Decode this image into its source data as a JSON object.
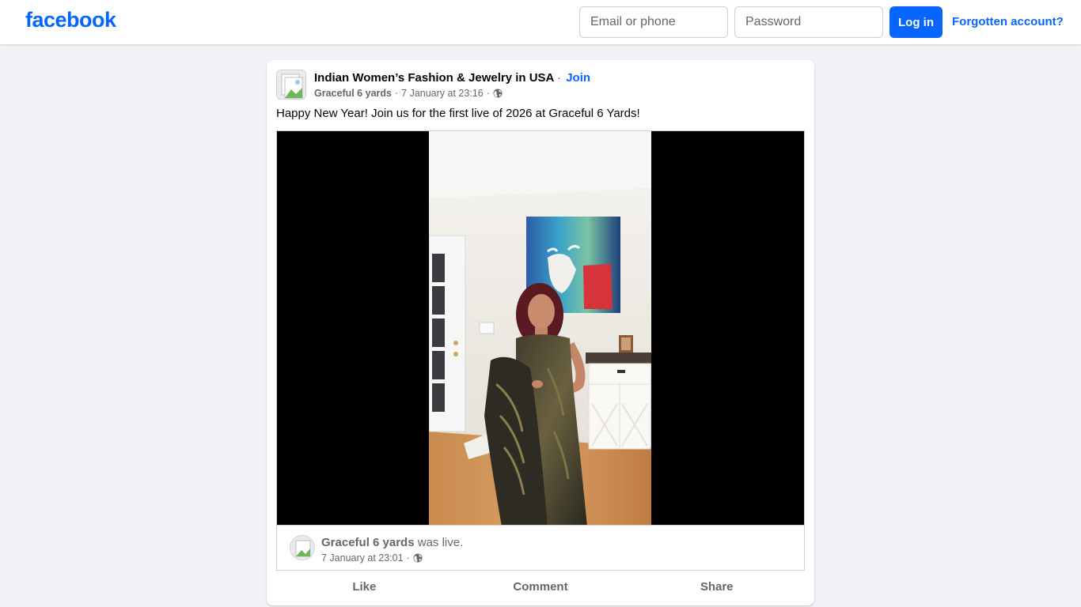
{
  "header": {
    "logo": "facebook",
    "email_placeholder": "Email or phone",
    "password_placeholder": "Password",
    "login_label": "Log in",
    "forgot_label": "Forgotten account?"
  },
  "post": {
    "group_name": "Indian Women’s Fashion & Jewelry in USA",
    "separator": "·",
    "join_label": "Join",
    "author": "Graceful 6 yards",
    "timestamp": "7 January at 23:16",
    "privacy_icon": "globe-icon",
    "text": "Happy New Year! Join us for the first live of 2026 at Graceful 6 Yards!",
    "live": {
      "page_name": "Graceful 6 yards",
      "status": "was live.",
      "timestamp": "7 January at 23:01"
    },
    "actions": {
      "like": "Like",
      "comment": "Comment",
      "share": "Share"
    }
  },
  "colors": {
    "brand": "#0866ff",
    "background": "#f0f2f5",
    "secondary_text": "#65676b"
  }
}
